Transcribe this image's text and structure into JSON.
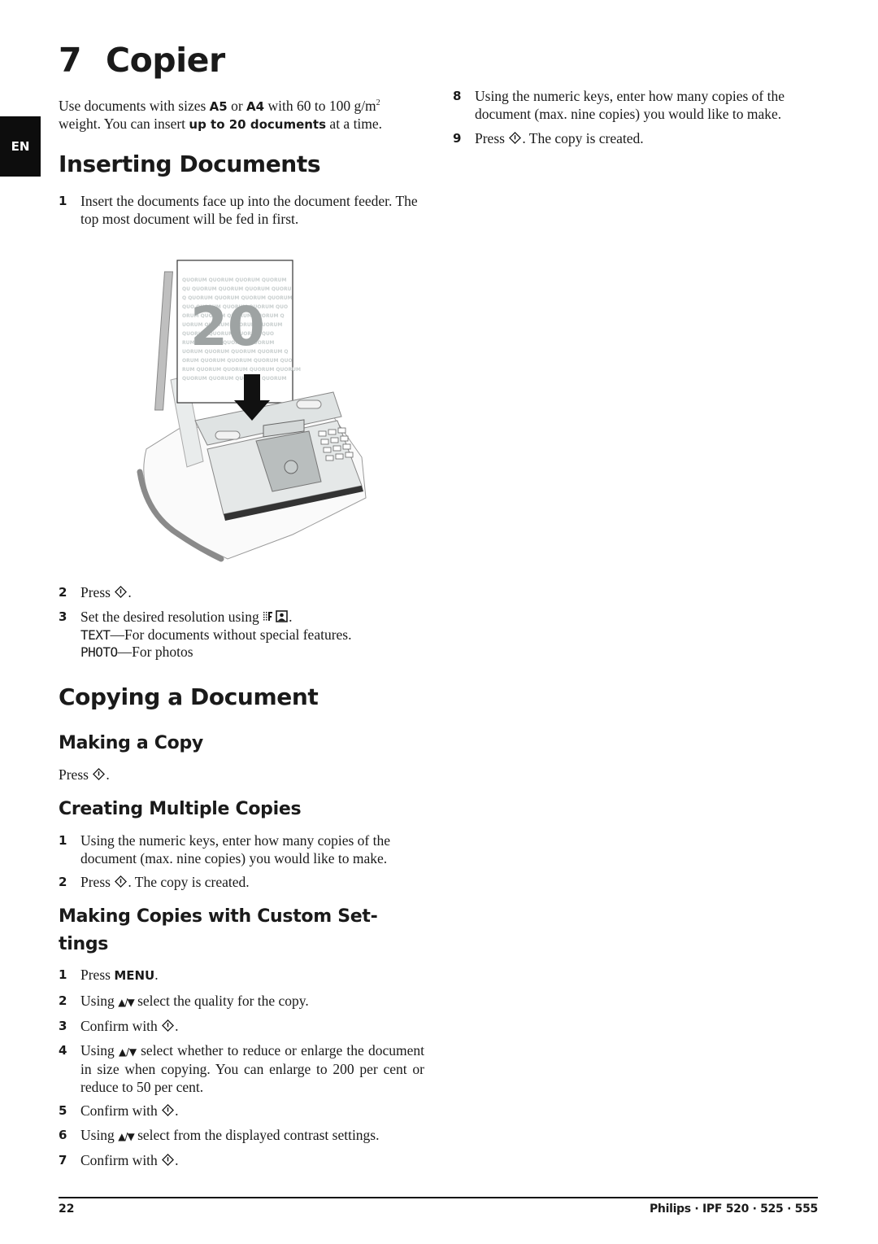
{
  "language_tab": "EN",
  "chapter": {
    "number": "7",
    "title": "Copier"
  },
  "intro": {
    "p1": "Use documents with sizes ",
    "b1": "A5",
    "p2": " or ",
    "b2": "A4",
    "p3": " with 60 to 100 g/m",
    "sup": "2",
    "p4": " weight. You can insert ",
    "b3": "up to 20 documents",
    "p5": " at a time."
  },
  "inserting": {
    "heading": "Inserting Documents",
    "step1": {
      "num": "1",
      "text": "Insert the documents face up into the document feeder. The top most document will be fed in first."
    },
    "illustration": {
      "description": "fax machine with stack of documents being inserted",
      "stack_label": "20",
      "watermark_word": "QUORUM"
    },
    "step2": {
      "num": "2",
      "text_before": "Press ",
      "text_after": "."
    },
    "step3": {
      "num": "3",
      "text_before": "Set the desired resolution using ",
      "text_after": ".",
      "text_option": {
        "key": "TEXT",
        "desc": "—For documents without special features."
      },
      "photo_option": {
        "key": "PHOTO",
        "desc": "—For photos"
      }
    }
  },
  "copying": {
    "heading": "Copying a Document",
    "making_copy": {
      "heading": "Making a Copy",
      "text_before": "Press ",
      "text_after": "."
    },
    "multiple": {
      "heading": "Creating Multiple Copies",
      "step1": {
        "num": "1",
        "text": "Using the numeric keys, enter how many copies of the document (max. nine copies) you would like to make."
      },
      "step2": {
        "num": "2",
        "text_before": "Press ",
        "text_after": ". The copy is created."
      }
    },
    "custom": {
      "heading_line1": "Making Copies with Custom Set-",
      "heading_line2": "tings",
      "steps": [
        {
          "num": "1",
          "before": "Press ",
          "key": "MENU",
          "after": "."
        },
        {
          "num": "2",
          "before": "Using ",
          "arrows": "▲/▼",
          "after": " select the quality for the copy."
        },
        {
          "num": "3",
          "before": "Confirm with ",
          "after": "."
        },
        {
          "num": "4",
          "before": "Using ",
          "arrows": "▲/▼",
          "after": " select whether to reduce or enlarge the document in size when copying. You can enlarge to 200 per cent or reduce to 50  per cent."
        },
        {
          "num": "5",
          "before": "Confirm with ",
          "after": "."
        },
        {
          "num": "6",
          "before": "Using ",
          "arrows": "▲/▼",
          "after": " select from the displayed contrast settings."
        },
        {
          "num": "7",
          "before": "Confirm with ",
          "after": "."
        }
      ],
      "step8": {
        "num": "8",
        "text": "Using the numeric keys, enter how many copies of the document (max. nine copies) you would like to make."
      },
      "step9": {
        "num": "9",
        "text_before": "Press ",
        "text_after": ". The copy is created."
      }
    }
  },
  "icons": {
    "start": "start-key-icon (diamond with vertical bar)",
    "resolution": "resolution-key-icon",
    "arrows": "up-down-arrow-keys"
  },
  "footer": {
    "page_number": "22",
    "product": "Philips · IPF 520 · 525 · 555"
  }
}
